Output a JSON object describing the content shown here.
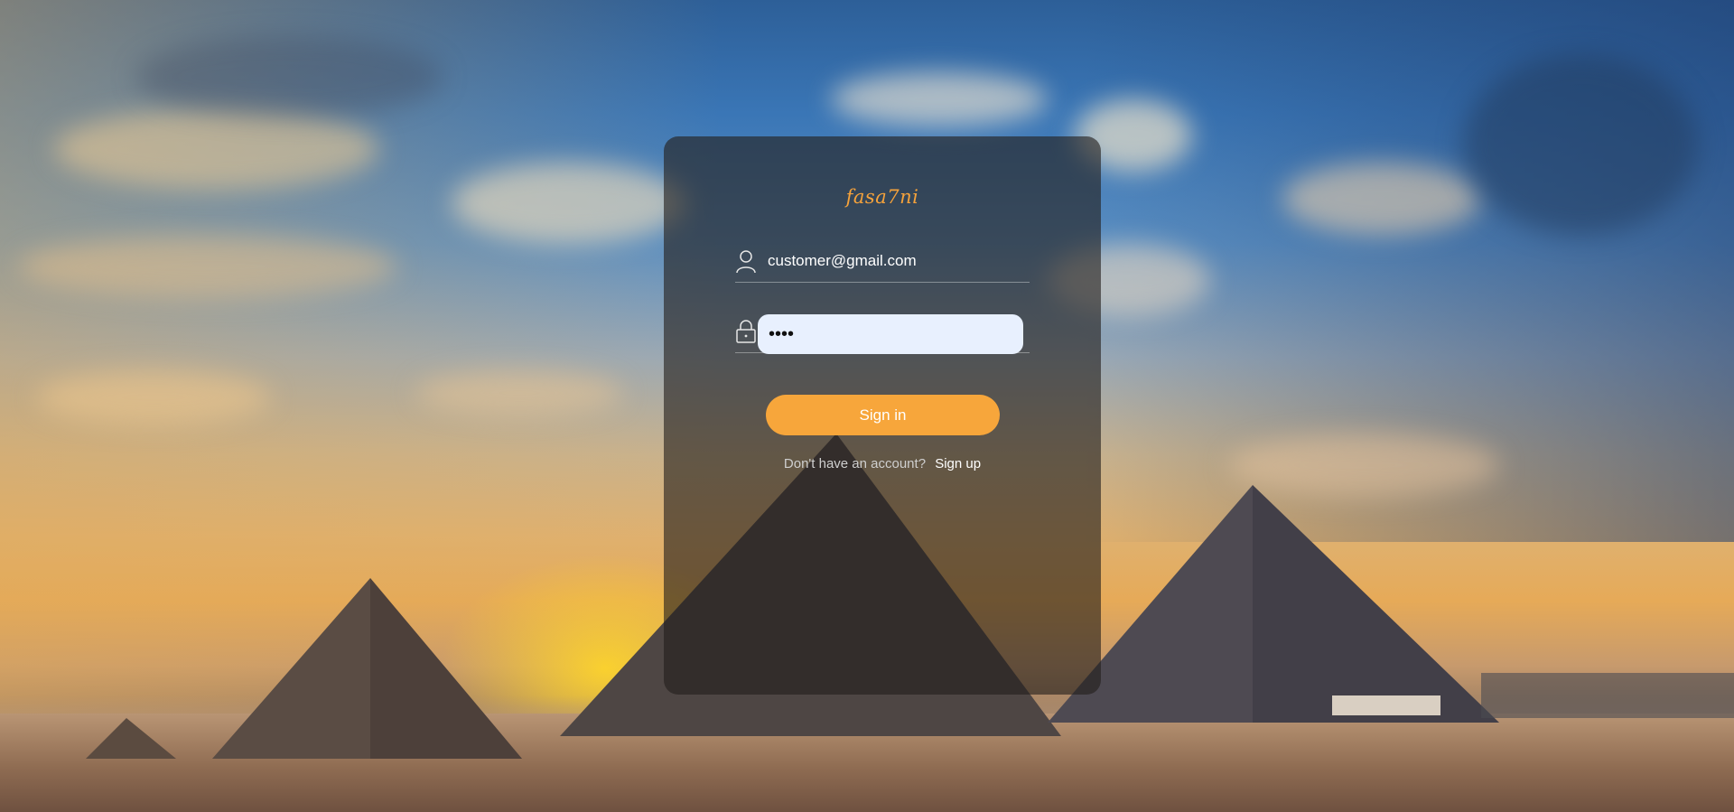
{
  "login": {
    "logo": "fasa7ni",
    "email": {
      "value": "customer@gmail.com",
      "icon": "user-icon"
    },
    "password": {
      "value": "••••",
      "icon": "lock-icon"
    },
    "signin_label": "Sign in",
    "no_account_text": "Don't have an account?",
    "signup_label": "Sign up"
  },
  "colors": {
    "accent": "#f7a63b",
    "input_fill": "#e8f0fe"
  }
}
